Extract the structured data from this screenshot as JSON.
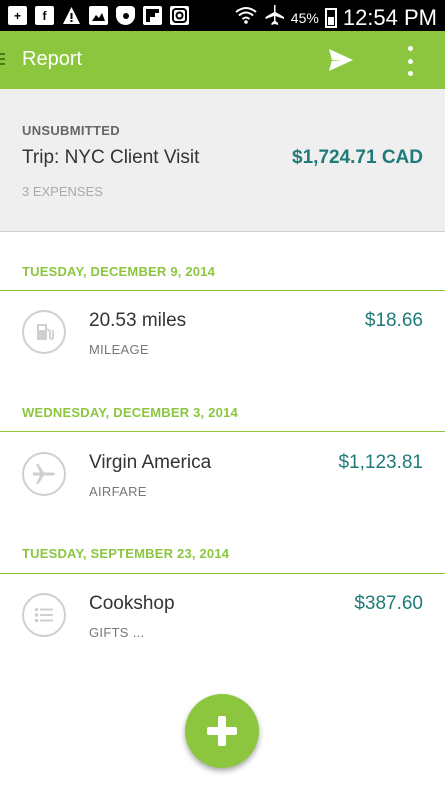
{
  "status_bar": {
    "left_icons": [
      "plus-box-icon",
      "facebook-icon",
      "warning-icon",
      "image-icon",
      "shield-icon",
      "flipboard-icon",
      "instagram-icon"
    ],
    "battery_percent": "45%",
    "time": "12:54 PM"
  },
  "app_bar": {
    "title": "Report",
    "color": "#8cc63f"
  },
  "report": {
    "status": "UNSUBMITTED",
    "trip_name": "Trip: NYC Client Visit",
    "total": "$1,724.71 CAD",
    "expense_count": "3 EXPENSES"
  },
  "groups": [
    {
      "date": "TUESDAY, DECEMBER 9, 2014",
      "expense": {
        "title": "20.53 miles",
        "category": "MILEAGE",
        "amount": "$18.66",
        "icon": "gas-pump-icon"
      }
    },
    {
      "date": "WEDNESDAY, DECEMBER 3, 2014",
      "expense": {
        "title": "Virgin America",
        "category": "AIRFARE",
        "amount": "$1,123.81",
        "icon": "airplane-icon"
      }
    },
    {
      "date": "TUESDAY, SEPTEMBER 23, 2014",
      "expense": {
        "title": "Cookshop",
        "category": "GIFTS ...",
        "amount": "$387.60",
        "icon": "list-icon"
      }
    }
  ],
  "colors": {
    "accent": "#8cc63f",
    "amount": "#1f7a78"
  }
}
